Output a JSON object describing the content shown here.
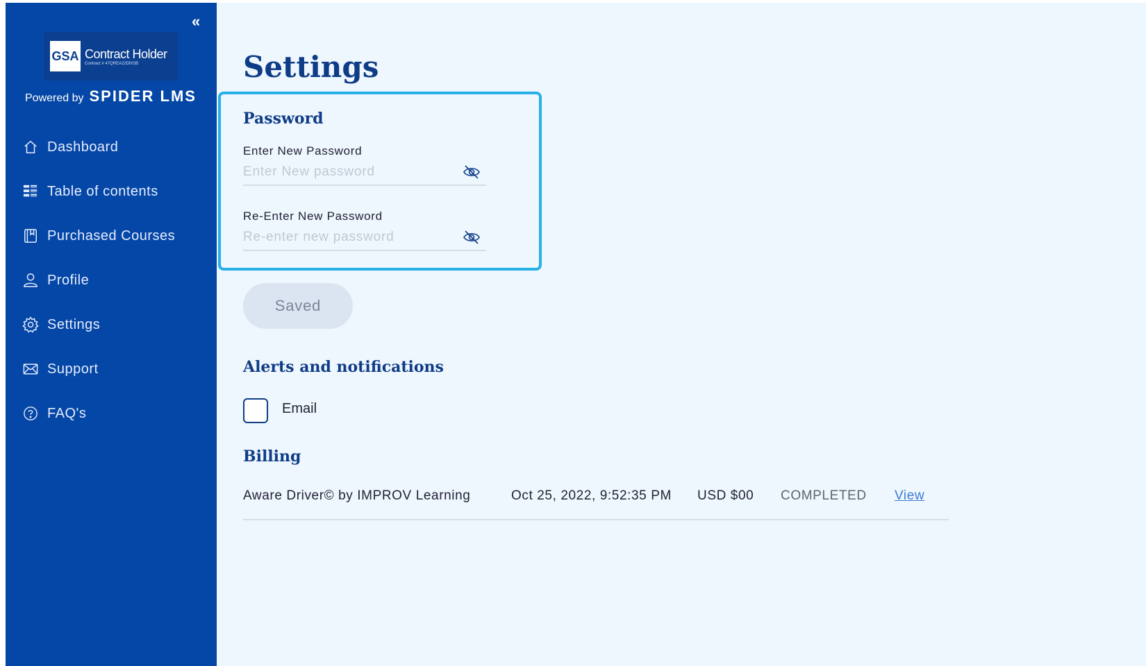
{
  "sidebar": {
    "collapse_glyph": "«",
    "logo": {
      "mark": "GSA",
      "title": "Contract Holder",
      "subtitle": "Contract # 47QREA22D0035"
    },
    "powered_label": "Powered by",
    "powered_brand": "SPIDER LMS",
    "items": [
      {
        "label": "Dashboard",
        "icon": "home-icon"
      },
      {
        "label": "Table of contents",
        "icon": "table-of-contents-icon"
      },
      {
        "label": "Purchased Courses",
        "icon": "book-icon"
      },
      {
        "label": "Profile",
        "icon": "user-icon"
      },
      {
        "label": "Settings",
        "icon": "gear-icon"
      },
      {
        "label": "Support",
        "icon": "mail-icon"
      },
      {
        "label": "FAQ's",
        "icon": "question-icon"
      }
    ]
  },
  "main": {
    "title": "Settings",
    "password": {
      "title": "Password",
      "new_label": "Enter New Password",
      "new_placeholder": "Enter New password",
      "new_value": "",
      "reenter_label": "Re-Enter New Password",
      "reenter_placeholder": "Re-enter new password",
      "reenter_value": ""
    },
    "saved_button": "Saved",
    "alerts": {
      "title": "Alerts and notifications",
      "email_label": "Email",
      "email_checked": false
    },
    "billing": {
      "title": "Billing",
      "rows": [
        {
          "course": "Aware Driver© by IMPROV Learning",
          "date": "Oct 25, 2022, 9:52:35 PM",
          "amount": "USD $00",
          "status": "COMPLETED",
          "action": "View"
        }
      ]
    }
  },
  "colors": {
    "sidebar": "#0547a6",
    "background": "#eef6fe",
    "heading": "#0e3c86",
    "highlight": "#26b0e6",
    "link": "#3d7bd1"
  }
}
